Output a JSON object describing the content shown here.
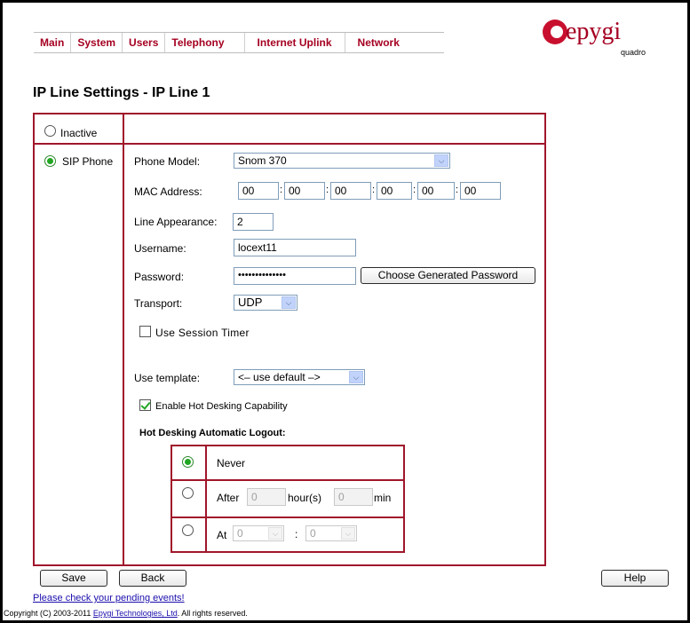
{
  "nav": {
    "items": [
      "Main",
      "System",
      "Users",
      "Telephony",
      "Internet Uplink",
      "Network"
    ]
  },
  "logo": {
    "word": "epygi",
    "sub": "quadro"
  },
  "page_title": "IP Line Settings - IP Line 1",
  "mode": {
    "inactive_label": "Inactive",
    "sip_phone_label": "SIP Phone",
    "selected": "SIP Phone"
  },
  "form": {
    "phone_model": {
      "label": "Phone Model:",
      "value": "Snom 370"
    },
    "mac": {
      "label": "MAC Address:",
      "octets": [
        "00",
        "00",
        "00",
        "00",
        "00",
        "00"
      ]
    },
    "line_appearance": {
      "label": "Line Appearance:",
      "value": "2"
    },
    "username": {
      "label": "Username:",
      "value": "locext11"
    },
    "password": {
      "label": "Password:",
      "value": "••••••••••••••",
      "generate_button": "Choose Generated Password"
    },
    "transport": {
      "label": "Transport:",
      "value": "UDP"
    },
    "session_timer": {
      "label": "Use Session Timer",
      "checked": false
    },
    "template": {
      "label": "Use template:",
      "value": "<– use default –>"
    },
    "hot_desking": {
      "label": "Enable Hot Desking Capability",
      "checked": true
    },
    "auto_logout": {
      "heading": "Hot Desking Automatic Logout:",
      "never_label": "Never",
      "after_label": "After",
      "after_hours": "0",
      "hours_unit": "hour(s)",
      "after_min": "0",
      "min_unit": "min",
      "at_label": "At",
      "at_hour": "0",
      "at_minute": "0",
      "at_sep": ":",
      "selected": "Never"
    }
  },
  "buttons": {
    "save": "Save",
    "back": "Back",
    "help": "Help"
  },
  "footer": {
    "pending_link": "Please check your pending events!",
    "copyright_pre": "Copyright (C) 2003-2011 ",
    "copyright_link": "Epygi Technologies, Ltd",
    "copyright_post": ". All rights reserved."
  },
  "colors": {
    "accent": "#a0162b",
    "nav_text": "#a50021",
    "radio_on": "#22a622"
  }
}
